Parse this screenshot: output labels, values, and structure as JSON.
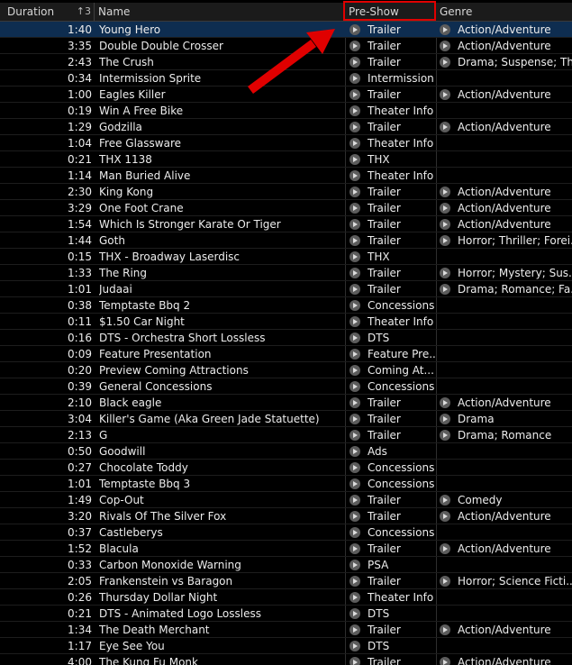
{
  "columns": {
    "duration": "Duration",
    "name": "Name",
    "preshow": "Pre-Show",
    "genre": "Genre",
    "sort_indicator": "↑3"
  },
  "rows": [
    {
      "duration": "1:40",
      "name": "Young Hero",
      "preshow": "Trailer",
      "genre": "Action/Adventure"
    },
    {
      "duration": "3:35",
      "name": "Double Double Crosser",
      "preshow": "Trailer",
      "genre": "Action/Adventure"
    },
    {
      "duration": "2:43",
      "name": "The Crush",
      "preshow": "Trailer",
      "genre": "Drama; Suspense; Th..."
    },
    {
      "duration": "0:34",
      "name": "Intermission Sprite",
      "preshow": "Intermission",
      "genre": ""
    },
    {
      "duration": "1:00",
      "name": "Eagles Killer",
      "preshow": "Trailer",
      "genre": "Action/Adventure"
    },
    {
      "duration": "0:19",
      "name": "Win A Free Bike",
      "preshow": "Theater Info",
      "genre": ""
    },
    {
      "duration": "1:29",
      "name": "Godzilla",
      "preshow": "Trailer",
      "genre": "Action/Adventure"
    },
    {
      "duration": "1:04",
      "name": "Free Glassware",
      "preshow": "Theater Info",
      "genre": ""
    },
    {
      "duration": "0:21",
      "name": "THX 1138",
      "preshow": "THX",
      "genre": ""
    },
    {
      "duration": "1:14",
      "name": "Man Buried Alive",
      "preshow": "Theater Info",
      "genre": ""
    },
    {
      "duration": "2:30",
      "name": "King Kong",
      "preshow": "Trailer",
      "genre": "Action/Adventure"
    },
    {
      "duration": "3:29",
      "name": "One Foot Crane",
      "preshow": "Trailer",
      "genre": "Action/Adventure"
    },
    {
      "duration": "1:54",
      "name": "Which Is Stronger Karate Or Tiger",
      "preshow": "Trailer",
      "genre": "Action/Adventure"
    },
    {
      "duration": "1:44",
      "name": "Goth",
      "preshow": "Trailer",
      "genre": "Horror; Thriller; Forei..."
    },
    {
      "duration": "0:15",
      "name": "THX - Broadway Laserdisc",
      "preshow": "THX",
      "genre": ""
    },
    {
      "duration": "1:33",
      "name": "The Ring",
      "preshow": "Trailer",
      "genre": "Horror; Mystery; Sus..."
    },
    {
      "duration": "1:01",
      "name": "Judaai",
      "preshow": "Trailer",
      "genre": "Drama; Romance; Fa..."
    },
    {
      "duration": "0:38",
      "name": "Temptaste Bbq 2",
      "preshow": "Concessions",
      "genre": ""
    },
    {
      "duration": "0:11",
      "name": "$1.50 Car Night",
      "preshow": "Theater Info",
      "genre": ""
    },
    {
      "duration": "0:16",
      "name": "DTS - Orchestra Short Lossless",
      "preshow": "DTS",
      "genre": ""
    },
    {
      "duration": "0:09",
      "name": "Feature Presentation",
      "preshow": "Feature Pre...",
      "genre": ""
    },
    {
      "duration": "0:20",
      "name": "Preview Coming Attractions",
      "preshow": "Coming At...",
      "genre": ""
    },
    {
      "duration": "0:39",
      "name": "General Concessions",
      "preshow": "Concessions",
      "genre": ""
    },
    {
      "duration": "2:10",
      "name": "Black eagle",
      "preshow": "Trailer",
      "genre": "Action/Adventure"
    },
    {
      "duration": "3:04",
      "name": "Killer's Game (Aka Green Jade Statuette)",
      "preshow": "Trailer",
      "genre": "Drama"
    },
    {
      "duration": "2:13",
      "name": "G",
      "preshow": "Trailer",
      "genre": "Drama; Romance"
    },
    {
      "duration": "0:50",
      "name": "Goodwill",
      "preshow": "Ads",
      "genre": ""
    },
    {
      "duration": "0:27",
      "name": "Chocolate Toddy",
      "preshow": "Concessions",
      "genre": ""
    },
    {
      "duration": "1:01",
      "name": "Temptaste Bbq 3",
      "preshow": "Concessions",
      "genre": ""
    },
    {
      "duration": "1:49",
      "name": "Cop-Out",
      "preshow": "Trailer",
      "genre": "Comedy"
    },
    {
      "duration": "3:20",
      "name": "Rivals Of The Silver Fox",
      "preshow": "Trailer",
      "genre": "Action/Adventure"
    },
    {
      "duration": "0:37",
      "name": "Castleberys",
      "preshow": "Concessions",
      "genre": ""
    },
    {
      "duration": "1:52",
      "name": "Blacula",
      "preshow": "Trailer",
      "genre": "Action/Adventure"
    },
    {
      "duration": "0:33",
      "name": "Carbon Monoxide Warning",
      "preshow": "PSA",
      "genre": ""
    },
    {
      "duration": "2:05",
      "name": "Frankenstein vs Baragon",
      "preshow": "Trailer",
      "genre": "Horror; Science Ficti..."
    },
    {
      "duration": "0:26",
      "name": "Thursday Dollar Night",
      "preshow": "Theater Info",
      "genre": ""
    },
    {
      "duration": "0:21",
      "name": "DTS - Animated Logo Lossless",
      "preshow": "DTS",
      "genre": ""
    },
    {
      "duration": "1:34",
      "name": "The Death Merchant",
      "preshow": "Trailer",
      "genre": "Action/Adventure"
    },
    {
      "duration": "1:17",
      "name": "Eye See You",
      "preshow": "DTS",
      "genre": ""
    },
    {
      "duration": "4:00",
      "name": "The Kung Fu Monk",
      "preshow": "Trailer",
      "genre": "Action/Adventure"
    }
  ],
  "selected_row": 0,
  "colors": {
    "background": "#000000",
    "selected": "#0e2d50",
    "annotation": "#e00000"
  }
}
